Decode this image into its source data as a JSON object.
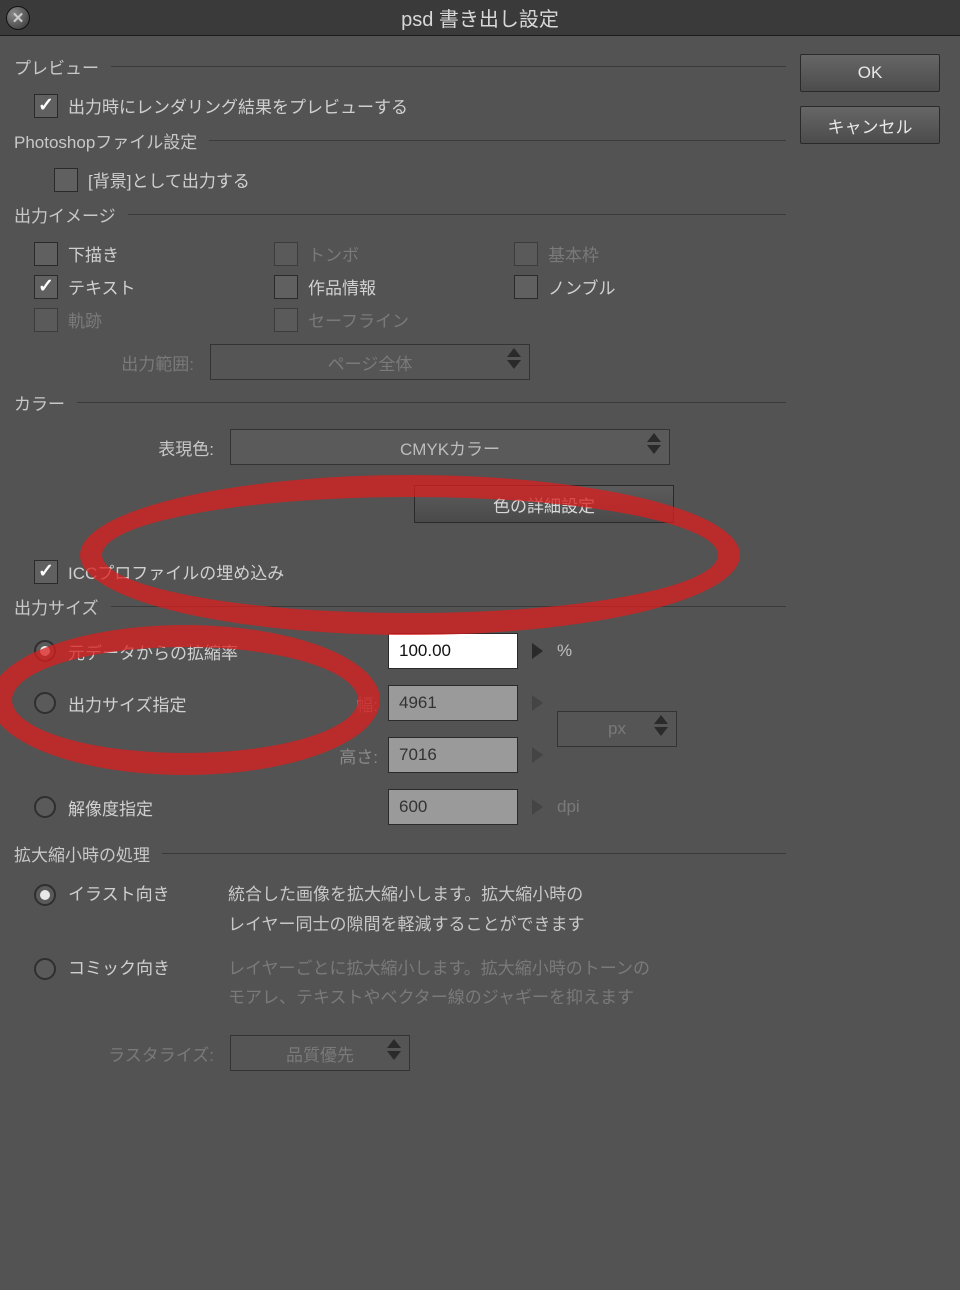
{
  "window": {
    "title": "psd 書き出し設定",
    "close": "✕"
  },
  "buttons": {
    "ok": "OK",
    "cancel": "キャンセル",
    "color_detail": "色の詳細設定"
  },
  "sections": {
    "preview": "プレビュー",
    "photoshop": "Photoshopファイル設定",
    "output_image": "出力イメージ",
    "color": "カラー",
    "output_size": "出力サイズ",
    "scaling": "拡大縮小時の処理"
  },
  "preview": {
    "checkbox_label": "出力時にレンダリング結果をプレビューする",
    "checked": true
  },
  "photoshop": {
    "bg_label": "[背景]として出力する",
    "bg_checked": false
  },
  "out_image": {
    "draft": "下描き",
    "draft_checked": false,
    "tombo": "トンボ",
    "tombo_checked": false,
    "basic_frame": "基本枠",
    "basic_checked": false,
    "text": "テキスト",
    "text_checked": true,
    "work_info": "作品情報",
    "work_checked": false,
    "nombre": "ノンブル",
    "nombre_checked": false,
    "trace": "軌跡",
    "trace_checked": false,
    "safeline": "セーフライン",
    "safeline_checked": false,
    "range_label": "出力範囲:",
    "range_value": "ページ全体"
  },
  "color": {
    "express_label": "表現色:",
    "express_value": "CMYKカラー",
    "icc_label": "ICCプロファイルの埋め込み",
    "icc_checked": true
  },
  "size": {
    "scale_label": "元データからの拡縮率",
    "scale_value": "100.00",
    "scale_unit": "%",
    "specify_label": "出力サイズ指定",
    "width_label": "幅:",
    "width_value": "4961",
    "height_label": "高さ:",
    "height_value": "7016",
    "px_unit": "px",
    "dpi_label": "解像度指定",
    "dpi_value": "600",
    "dpi_unit": "dpi"
  },
  "scaling": {
    "illust_label": "イラスト向き",
    "illust_desc1": "統合した画像を拡大縮小します。拡大縮小時の",
    "illust_desc2": "レイヤー同士の隙間を軽減することができます",
    "comic_label": "コミック向き",
    "comic_desc1": "レイヤーごとに拡大縮小します。拡大縮小時のトーンの",
    "comic_desc2": "モアレ、テキストやベクター線のジャギーを抑えます",
    "raster_label": "ラスタライズ:",
    "raster_value": "品質優先"
  }
}
